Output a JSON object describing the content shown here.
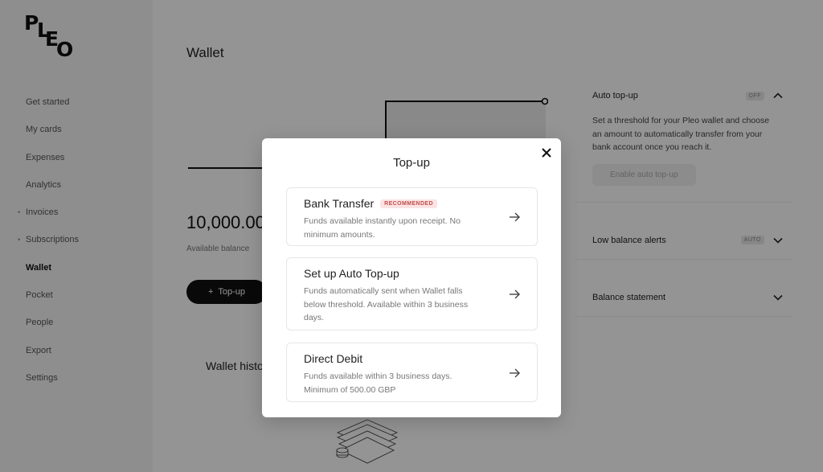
{
  "app": {
    "logo_letters": [
      "P",
      "L",
      "E",
      "O"
    ]
  },
  "sidebar": {
    "items": [
      {
        "label": "Get started",
        "dot": false,
        "active": false
      },
      {
        "label": "My cards",
        "dot": false,
        "active": false
      },
      {
        "label": "Expenses",
        "dot": false,
        "active": false
      },
      {
        "label": "Analytics",
        "dot": false,
        "active": false
      },
      {
        "label": "Invoices",
        "dot": true,
        "active": false
      },
      {
        "label": "Subscriptions",
        "dot": true,
        "active": false
      },
      {
        "label": "Wallet",
        "dot": false,
        "active": true
      },
      {
        "label": "Pocket",
        "dot": false,
        "active": false
      },
      {
        "label": "People",
        "dot": false,
        "active": false
      },
      {
        "label": "Export",
        "dot": false,
        "active": false
      },
      {
        "label": "Settings",
        "dot": false,
        "active": false
      }
    ]
  },
  "main": {
    "title": "Wallet",
    "balance": "10,000.00",
    "balance_label": "Available balance",
    "topup_label": "Top-up",
    "history_title": "Wallet history"
  },
  "right_panel": {
    "auto_topup": {
      "title": "Auto top-up",
      "status": "OFF",
      "description": "Set a threshold for your Pleo wallet and choose an amount to automatically transfer from your bank account once you reach it.",
      "button": "Enable auto top-up"
    },
    "low_balance": {
      "title": "Low balance alerts",
      "status": "AUTO"
    },
    "statement": {
      "title": "Balance statement"
    }
  },
  "modal": {
    "title": "Top-up",
    "options": [
      {
        "title": "Bank Transfer",
        "badge": "RECOMMENDED",
        "description": "Funds available instantly upon receipt. No minimum amounts."
      },
      {
        "title": "Set up Auto Top-up",
        "badge": "",
        "description": "Funds automatically sent when Wallet falls below threshold. Available within 3 business days."
      },
      {
        "title": "Direct Debit",
        "badge": "",
        "description": "Funds available within 3 business days. Minimum of 500.00 GBP"
      }
    ]
  },
  "colors": {
    "badge_bg": "#fbe3e3",
    "badge_text": "#c0504d",
    "overlay": "rgba(0,0,0,0.42)"
  },
  "icons": {
    "close": "close-icon",
    "arrow": "arrow-right-icon",
    "chevron_up": "chevron-up-icon",
    "chevron_down": "chevron-down-icon",
    "plus": "plus-icon"
  }
}
